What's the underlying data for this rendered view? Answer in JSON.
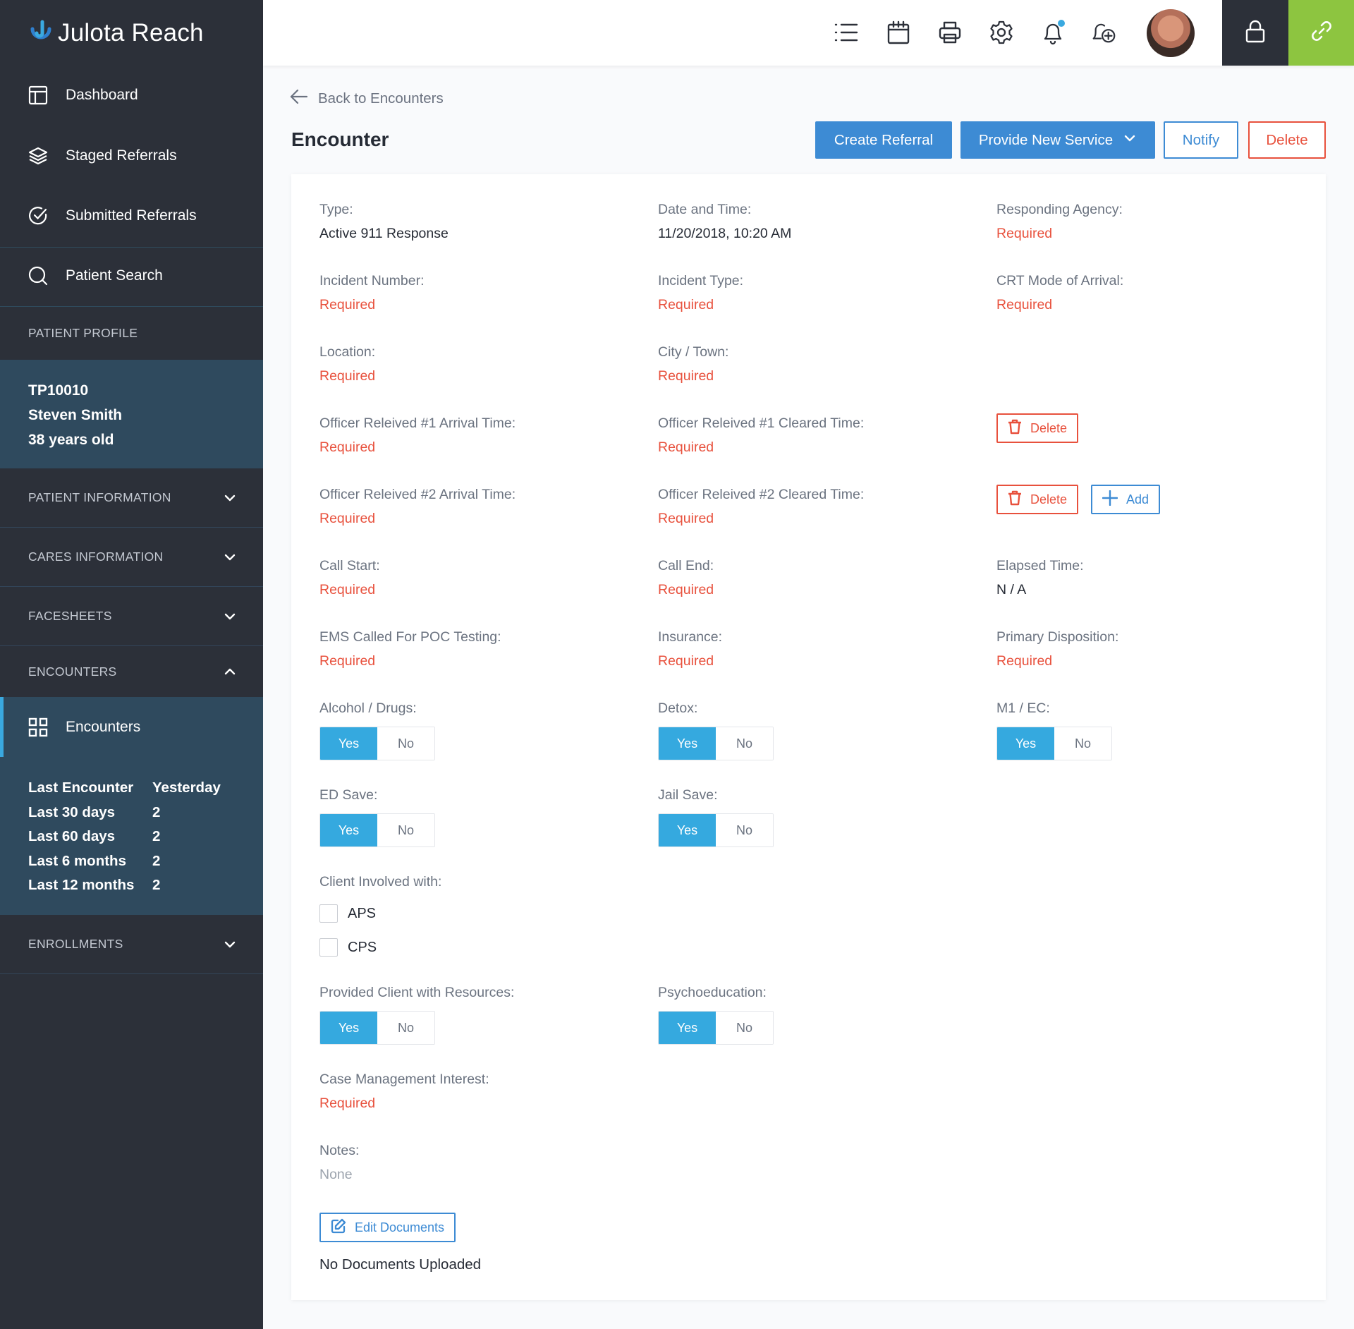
{
  "app": {
    "name": "Julota Reach",
    "accent": "#3aa9e0",
    "success": "#8dc540",
    "danger": "#e8513d",
    "primary": "#3d8bd4"
  },
  "sidebar": {
    "nav": [
      {
        "label": "Dashboard",
        "icon": "dashboard-icon"
      },
      {
        "label": "Staged Referrals",
        "icon": "layers-icon"
      },
      {
        "label": "Submitted Referrals",
        "icon": "check-circle-icon"
      },
      {
        "label": "Patient Search",
        "icon": "search-icon"
      }
    ],
    "patient_profile_heading": "PATIENT PROFILE",
    "patient": {
      "id": "TP10010",
      "name": "Steven Smith",
      "age": "38 years old"
    },
    "sections": [
      {
        "label": "PATIENT INFORMATION",
        "expanded": false
      },
      {
        "label": "CARES INFORMATION",
        "expanded": false
      },
      {
        "label": "FACESHEETS",
        "expanded": false
      },
      {
        "label": "ENCOUNTERS",
        "expanded": true
      },
      {
        "label": "ENROLLMENTS",
        "expanded": false
      }
    ],
    "encounters_item": {
      "label": "Encounters",
      "icon": "grid-icon"
    },
    "encounter_stats": [
      {
        "label": "Last Encounter",
        "value": "Yesterday"
      },
      {
        "label": "Last 30 days",
        "value": "2"
      },
      {
        "label": "Last 60 days",
        "value": "2"
      },
      {
        "label": "Last 6 months",
        "value": "2"
      },
      {
        "label": "Last 12 months",
        "value": "2"
      }
    ]
  },
  "header": {
    "icons": [
      "list-icon",
      "calendar-icon",
      "printer-icon",
      "gear-icon",
      "bell-icon",
      "bell-plus-icon"
    ],
    "notification_dot": true
  },
  "main": {
    "back_label": "Back to Encounters",
    "title": "Encounter",
    "actions": {
      "create_referral": "Create Referral",
      "provide_new_service": "Provide New Service",
      "notify": "Notify",
      "delete": "Delete"
    },
    "fields": {
      "type": {
        "label": "Type:",
        "value": "Active 911 Response"
      },
      "date_time": {
        "label": "Date and Time:",
        "value": "11/20/2018, 10:20 AM"
      },
      "responding_agency": {
        "label": "Responding Agency:",
        "value": "Required"
      },
      "incident_number": {
        "label": "Incident Number:",
        "value": "Required"
      },
      "incident_type": {
        "label": "Incident Type:",
        "value": "Required"
      },
      "crt_mode": {
        "label": "CRT Mode of Arrival:",
        "value": "Required"
      },
      "location": {
        "label": "Location:",
        "value": "Required"
      },
      "city_town": {
        "label": "City / Town:",
        "value": "Required"
      },
      "officer1_arrival": {
        "label": "Officer Releived #1 Arrival Time:",
        "value": "Required"
      },
      "officer1_cleared": {
        "label": "Officer Releived #1 Cleared Time:",
        "value": "Required"
      },
      "officer2_arrival": {
        "label": "Officer Releived #2 Arrival Time:",
        "value": "Required"
      },
      "officer2_cleared": {
        "label": "Officer Releived #2 Cleared Time:",
        "value": "Required"
      },
      "call_start": {
        "label": "Call Start:",
        "value": "Required"
      },
      "call_end": {
        "label": "Call End:",
        "value": "Required"
      },
      "elapsed_time": {
        "label": "Elapsed Time:",
        "value": "N / A"
      },
      "ems_poc": {
        "label": "EMS Called For POC Testing:",
        "value": "Required"
      },
      "insurance": {
        "label": "Insurance:",
        "value": "Required"
      },
      "primary_disposition": {
        "label": "Primary Disposition:",
        "value": "Required"
      },
      "case_mgmt": {
        "label": "Case Management Interest:",
        "value": "Required"
      },
      "notes": {
        "label": "Notes:",
        "value": "None"
      }
    },
    "toggles": {
      "yes": "Yes",
      "no": "No",
      "alcohol_drugs": {
        "label": "Alcohol / Drugs:",
        "selected": "Yes"
      },
      "detox": {
        "label": "Detox:",
        "selected": "Yes"
      },
      "m1_ec": {
        "label": "M1 / EC:",
        "selected": "Yes"
      },
      "ed_save": {
        "label": "ED Save:",
        "selected": "Yes"
      },
      "jail_save": {
        "label": "Jail Save:",
        "selected": "Yes"
      },
      "provided_resources": {
        "label": "Provided Client with Resources:",
        "selected": "Yes"
      },
      "psychoeducation": {
        "label": "Psychoeducation:",
        "selected": "Yes"
      }
    },
    "client_involved": {
      "label": "Client Involved with:",
      "options": [
        {
          "label": "APS",
          "checked": false
        },
        {
          "label": "CPS",
          "checked": false
        }
      ]
    },
    "row_buttons": {
      "delete": "Delete",
      "add": "Add"
    },
    "documents": {
      "edit_label": "Edit Documents",
      "status": "No Documents Uploaded"
    }
  }
}
